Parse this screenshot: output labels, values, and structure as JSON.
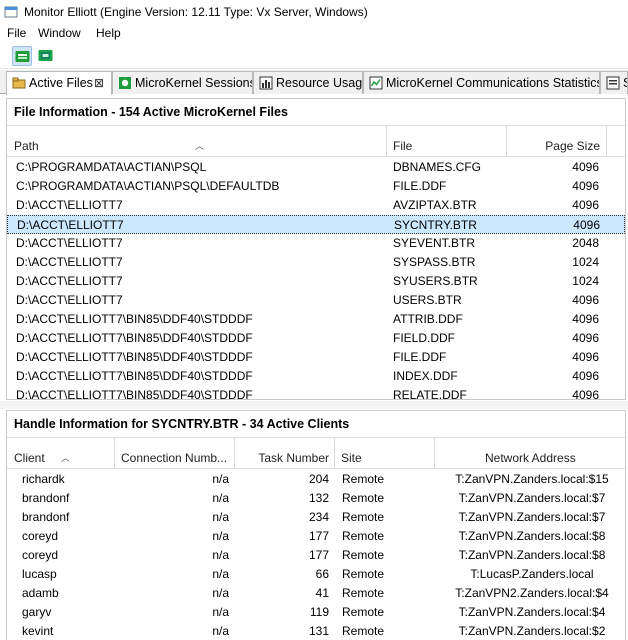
{
  "window": {
    "title": "Monitor Elliott  (Engine Version: 12.11  Type: Vx Server, Windows)"
  },
  "menu": [
    "File",
    "Window",
    "Help"
  ],
  "toolbar": {
    "buttons": [
      {
        "icon": "refresh-green-icon",
        "pressed": true
      },
      {
        "icon": "refresh-alt-green-icon",
        "pressed": false
      }
    ]
  },
  "tabs": [
    {
      "label": "Active Files",
      "close": "⊠",
      "active": true,
      "icon": "active-files-icon"
    },
    {
      "label": "MicroKernel Sessions",
      "active": false,
      "icon": "sessions-icon"
    },
    {
      "label": "Resource Usage",
      "active": false,
      "icon": "bar-chart-icon"
    },
    {
      "label": "MicroKernel Communications Statistics",
      "active": false,
      "icon": "line-chart-icon"
    },
    {
      "label": "S",
      "active": false,
      "icon": "stats-icon"
    }
  ],
  "files": {
    "title": "File Information - 154 Active MicroKernel Files",
    "columns": [
      "Path",
      "File",
      "Page Size"
    ],
    "rows": [
      [
        "C:\\PROGRAMDATA\\ACTIAN\\PSQL",
        "DBNAMES.CFG",
        "4096"
      ],
      [
        "C:\\PROGRAMDATA\\ACTIAN\\PSQL\\DEFAULTDB",
        "FILE.DDF",
        "4096"
      ],
      [
        "D:\\ACCT\\ELLIOTT7",
        "AVZIPTAX.BTR",
        "4096"
      ],
      [
        "D:\\ACCT\\ELLIOTT7",
        "SYCNTRY.BTR",
        "4096"
      ],
      [
        "D:\\ACCT\\ELLIOTT7",
        "SYEVENT.BTR",
        "2048"
      ],
      [
        "D:\\ACCT\\ELLIOTT7",
        "SYSPASS.BTR",
        "1024"
      ],
      [
        "D:\\ACCT\\ELLIOTT7",
        "SYUSERS.BTR",
        "1024"
      ],
      [
        "D:\\ACCT\\ELLIOTT7",
        "USERS.BTR",
        "4096"
      ],
      [
        "D:\\ACCT\\ELLIOTT7\\BIN85\\DDF40\\STDDDF",
        "ATTRIB.DDF",
        "4096"
      ],
      [
        "D:\\ACCT\\ELLIOTT7\\BIN85\\DDF40\\STDDDF",
        "FIELD.DDF",
        "4096"
      ],
      [
        "D:\\ACCT\\ELLIOTT7\\BIN85\\DDF40\\STDDDF",
        "FILE.DDF",
        "4096"
      ],
      [
        "D:\\ACCT\\ELLIOTT7\\BIN85\\DDF40\\STDDDF",
        "INDEX.DDF",
        "4096"
      ],
      [
        "D:\\ACCT\\ELLIOTT7\\BIN85\\DDF40\\STDDDF",
        "RELATE.DDF",
        "4096"
      ]
    ],
    "selected_index": 3
  },
  "handles": {
    "title": "Handle Information for SYCNTRY.BTR - 34 Active Clients",
    "columns": [
      "Client",
      "Connection Numb...",
      "Task Number",
      "Site",
      "Network Address"
    ],
    "rows": [
      [
        "richardk",
        "n/a",
        "204",
        "Remote",
        "T:ZanVPN.Zanders.local:$15"
      ],
      [
        "brandonf",
        "n/a",
        "132",
        "Remote",
        "T:ZanVPN.Zanders.local:$7"
      ],
      [
        "brandonf",
        "n/a",
        "234",
        "Remote",
        "T:ZanVPN.Zanders.local:$7"
      ],
      [
        "coreyd",
        "n/a",
        "177",
        "Remote",
        "T:ZanVPN.Zanders.local:$8"
      ],
      [
        "coreyd",
        "n/a",
        "177",
        "Remote",
        "T:ZanVPN.Zanders.local:$8"
      ],
      [
        "lucasp",
        "n/a",
        "66",
        "Remote",
        "T:LucasP.Zanders.local"
      ],
      [
        "adamb",
        "n/a",
        "41",
        "Remote",
        "T:ZanVPN2.Zanders.local:$4"
      ],
      [
        "garyv",
        "n/a",
        "119",
        "Remote",
        "T:ZanVPN.Zanders.local:$4"
      ],
      [
        "kevint",
        "n/a",
        "131",
        "Remote",
        "T:ZanVPN.Zanders.local:$2"
      ]
    ]
  },
  "colors": {
    "selection": "#cce8ff",
    "icon_green": "#1f9d3a",
    "icon_teal": "#0a7a6a"
  }
}
